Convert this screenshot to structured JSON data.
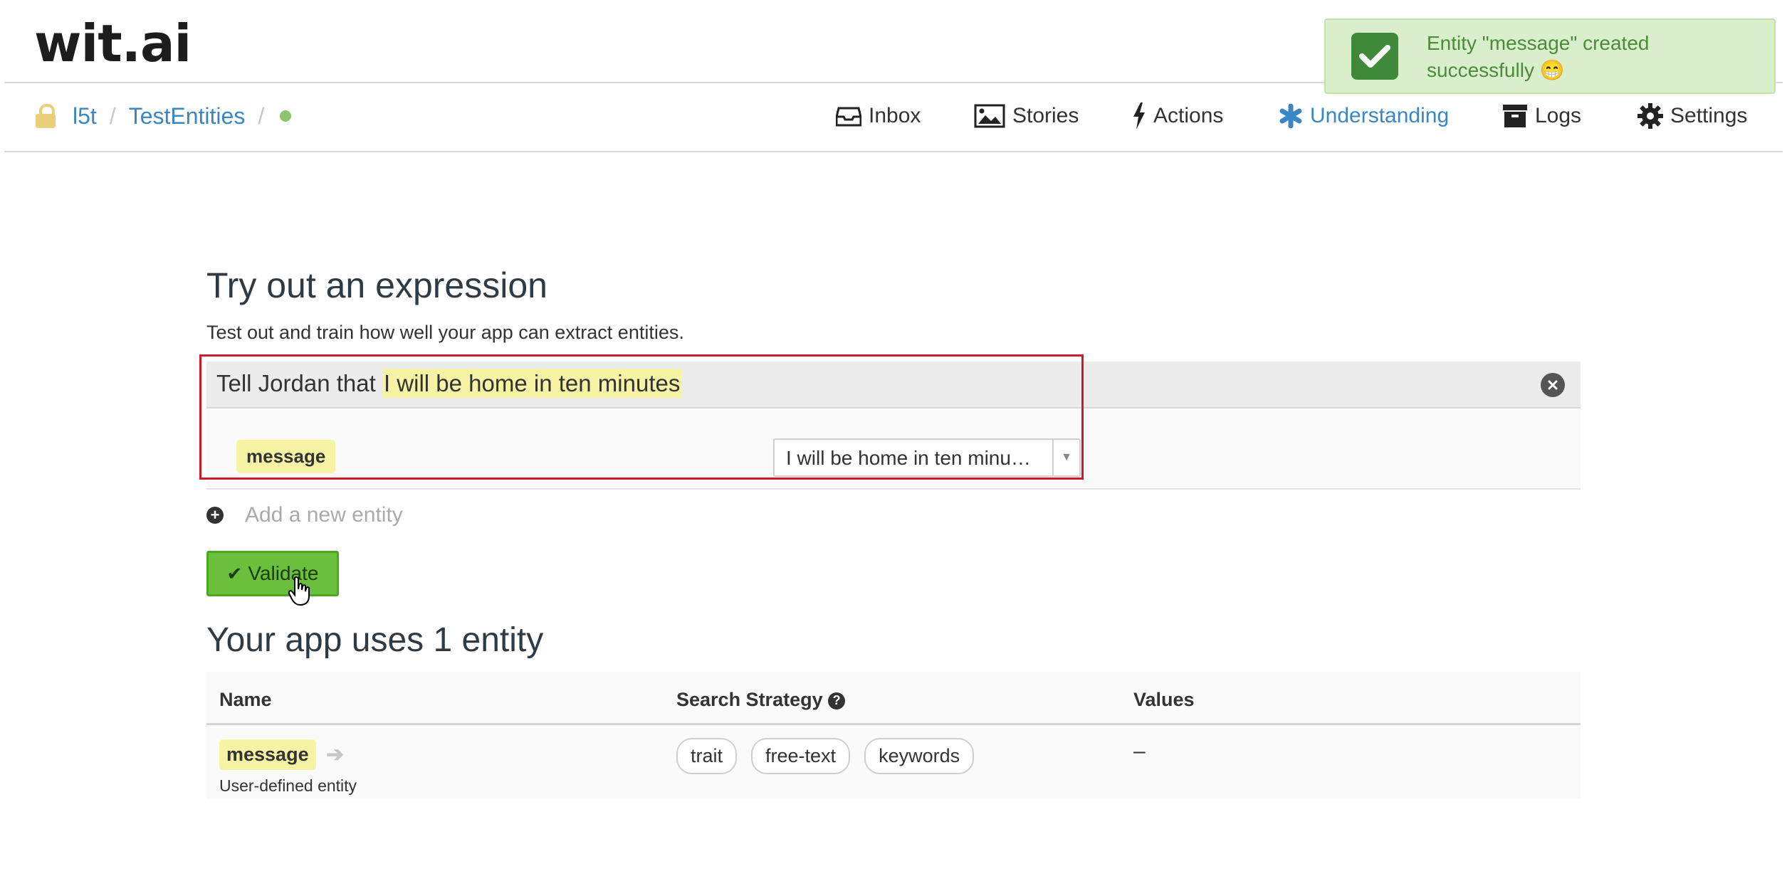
{
  "header": {
    "logo": "wit.ai",
    "breadcrumb": {
      "user": "l5t",
      "separator": "/",
      "app": "TestEntities"
    },
    "nav": [
      {
        "label": "Inbox",
        "icon": "inbox-icon"
      },
      {
        "label": "Stories",
        "icon": "image-icon"
      },
      {
        "label": "Actions",
        "icon": "bolt-icon"
      },
      {
        "label": "Understanding",
        "icon": "asterisk-icon",
        "active": true
      },
      {
        "label": "Logs",
        "icon": "archive-icon"
      },
      {
        "label": "Settings",
        "icon": "gear-icon"
      }
    ]
  },
  "toast": {
    "message": "Entity \"message\" created successfully 😁",
    "icon": "check-icon",
    "color": "#d9efcb"
  },
  "tryout": {
    "title": "Try out an expression",
    "subtitle": "Test out and train how well your app can extract entities.",
    "expression_prefix": "Tell Jordan that ",
    "expression_highlight": "I will be home in ten minutes",
    "entity": {
      "name": "message",
      "value": "I will be home in ten minu…"
    },
    "add_entity_placeholder": "Add a new entity",
    "validate_label": "Validate"
  },
  "entities": {
    "title": "Your app uses 1 entity",
    "columns": [
      "Name",
      "Search Strategy",
      "Values"
    ],
    "rows": [
      {
        "name": "message",
        "description": "User-defined entity",
        "strategies": [
          "trait",
          "free-text",
          "keywords"
        ],
        "values": "–"
      }
    ]
  },
  "colors": {
    "accent": "#3a87c4",
    "highlight": "#f6f4a4",
    "validate": "#6abf3d",
    "annotation": "#d0192b"
  }
}
